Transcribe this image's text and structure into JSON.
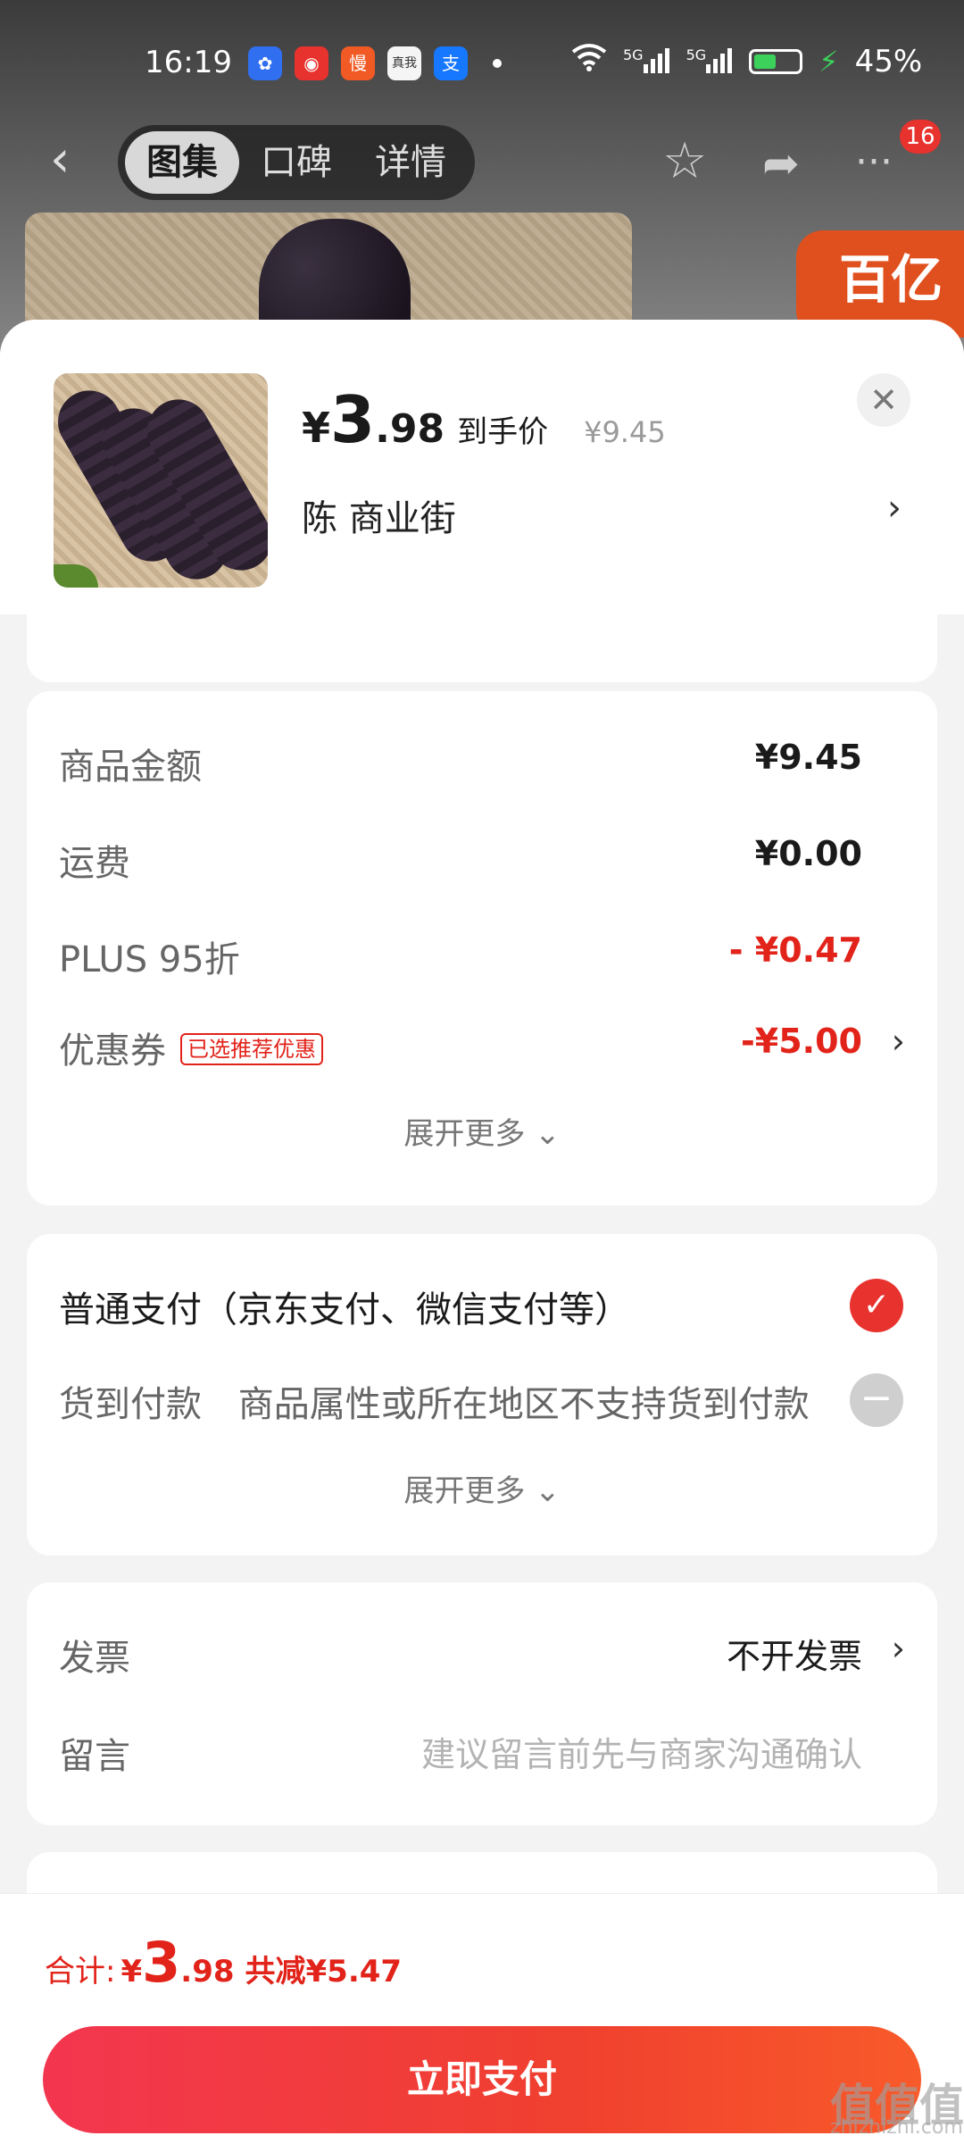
{
  "status": {
    "time": "16:19",
    "apps": [
      {
        "name": "baidu-icon",
        "color": "#2f6ff0",
        "glyph": "✿"
      },
      {
        "name": "jd-icon",
        "color": "#e8322e",
        "glyph": "◉"
      },
      {
        "name": "manmanbuy-icon",
        "color": "#f15a24",
        "glyph": "慢"
      },
      {
        "name": "realme-icon",
        "color": "#f5f5f5",
        "glyph": "真我"
      },
      {
        "name": "alipay-icon",
        "color": "#1677ff",
        "glyph": "支"
      }
    ],
    "network": "5G",
    "battery": "45%"
  },
  "nav": {
    "back_glyph": "‹",
    "tabs": [
      "图集",
      "口碑",
      "详情"
    ],
    "active_tab": "图集",
    "star_glyph": "☆",
    "share_glyph": "➦",
    "more_glyph": "···",
    "badge": "16"
  },
  "background": {
    "badge_text": "百亿"
  },
  "product": {
    "price_symbol": "¥",
    "price_int": "3",
    "price_dec": ".98",
    "price_tag": "到手价",
    "price_original": "¥9.45",
    "address": "陈  商业街",
    "close_glyph": "✕",
    "arrow_glyph": "›"
  },
  "costs": {
    "rows": [
      {
        "label": "商品金额",
        "value": "¥9.45"
      },
      {
        "label": "运费",
        "value": "¥0.00"
      },
      {
        "label": "PLUS 95折",
        "value": "- ¥0.47"
      },
      {
        "label": "优惠券",
        "tag": "已选推荐优惠",
        "value": "-¥5.00"
      }
    ],
    "expand": "展开更多 ⌄"
  },
  "payment": {
    "normal": "普通支付（京东支付、微信支付等）",
    "cod_label": "货到付款",
    "cod_note": "商品属性或所在地区不支持货到付款",
    "check_glyph": "✓",
    "minus_glyph": "−",
    "expand": "展开更多 ⌄"
  },
  "extra": {
    "invoice_label": "发票",
    "invoice_value": "不开发票",
    "note_label": "留言",
    "note_placeholder": "建议留言前先与商家沟通确认"
  },
  "footer": {
    "total_label": "合计:",
    "total_symbol": "¥",
    "total_int": "3",
    "total_dec": ".98",
    "total_off": "共减¥5.47",
    "pay_button": "立即支付",
    "watermark": "值值值",
    "watermark_sub": "zhizhizhi.com"
  },
  "colors": {
    "accent_red": "#e2231a",
    "pay_gradient_start": "#f3364f",
    "pay_gradient_end": "#f85a2a"
  }
}
